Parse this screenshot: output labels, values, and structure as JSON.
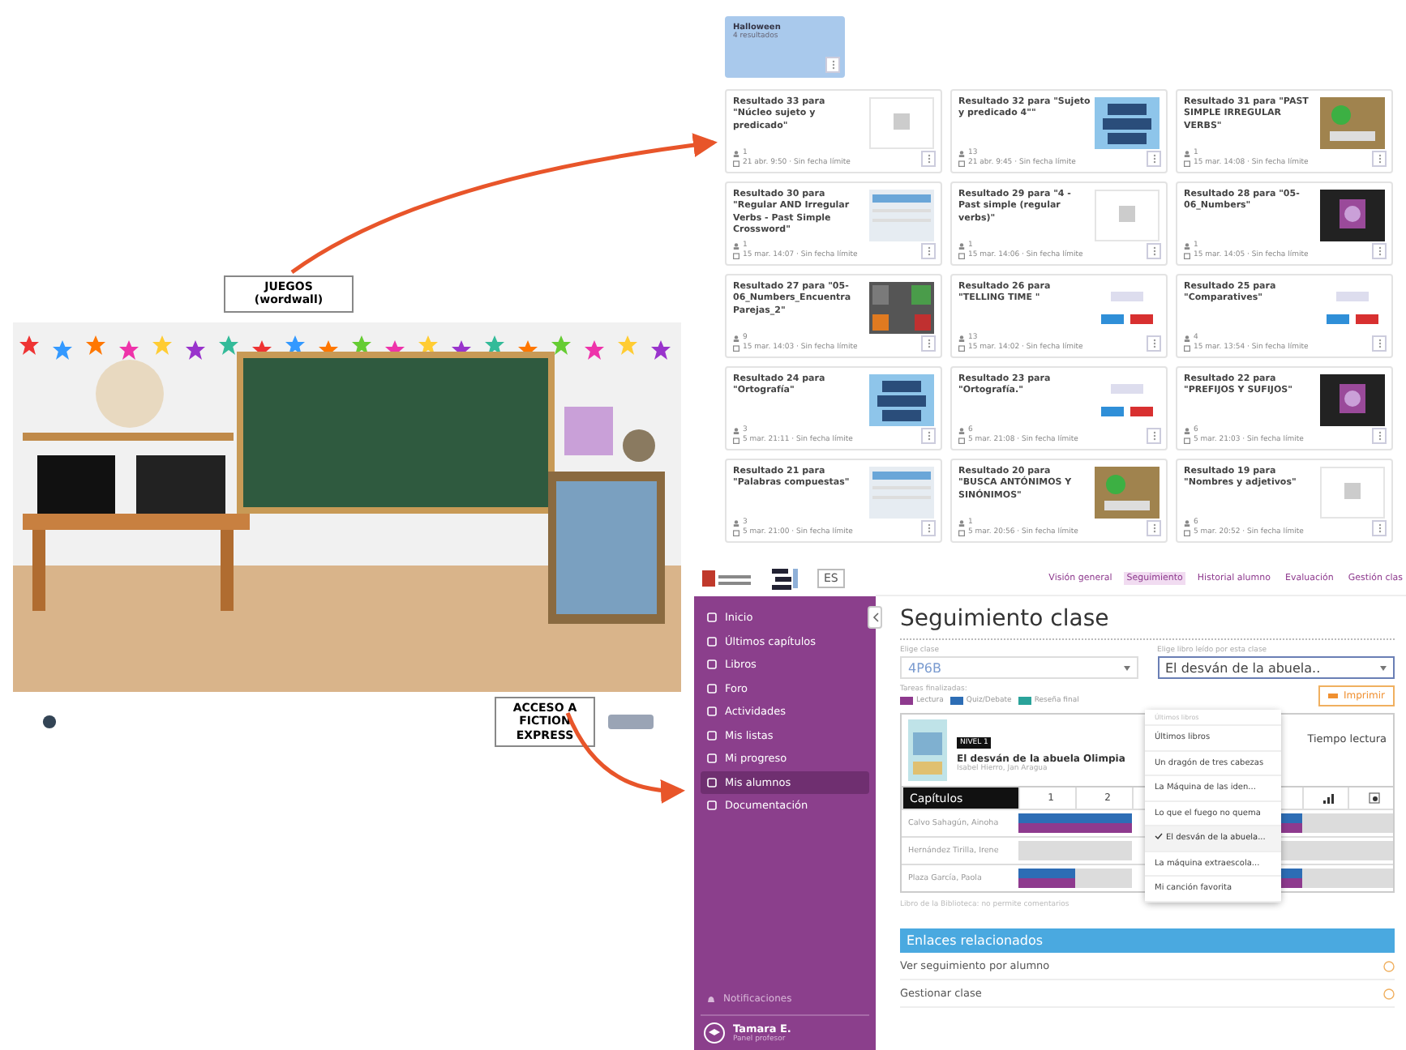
{
  "annotations": {
    "games_label": "JUEGOS (wordwall)",
    "fiction_label": "ACCESO A FICTION EXPRESS"
  },
  "wordwall": {
    "folder": {
      "title": "Halloween",
      "count": "4 resultados"
    },
    "results": [
      {
        "title": "Resultado 33 para \"Núcleo sujeto y predicado\"",
        "players": "1",
        "date": "21 abr. 9:50 · Sin fecha límite",
        "kind": "placeholder"
      },
      {
        "title": "Resultado 32 para \"Sujeto y predicado 4\"\"",
        "players": "13",
        "date": "21 abr. 9:45 · Sin fecha límite",
        "kind": "tiles"
      },
      {
        "title": "Resultado 31 para \"PAST SIMPLE IRREGULAR VERBS\"",
        "players": "1",
        "date": "15 mar. 14:08 · Sin fecha límite",
        "kind": "board"
      },
      {
        "title": "Resultado 30 para \"Regular AND Irregular Verbs - Past Simple Crossword\"",
        "players": "1",
        "date": "15 mar. 14:07 · Sin fecha límite",
        "kind": "lines"
      },
      {
        "title": "Resultado 29 para \"4 - Past simple (regular verbs)\"",
        "players": "1",
        "date": "15 mar. 14:06 · Sin fecha límite",
        "kind": "placeholder"
      },
      {
        "title": "Resultado 28 para \"05-06_Numbers\"",
        "players": "1",
        "date": "15 mar. 14:05 · Sin fecha límite",
        "kind": "dark"
      },
      {
        "title": "Resultado 27 para \"05-06_Numbers_Encuentra Parejas_2\"",
        "players": "9",
        "date": "15 mar. 14:03 · Sin fecha límite",
        "kind": "mosaic"
      },
      {
        "title": "Resultado 26 para \"TELLING TIME \"",
        "players": "13",
        "date": "15 mar. 14:02 · Sin fecha límite",
        "kind": "light"
      },
      {
        "title": "Resultado 25 para \"Comparatives\"",
        "players": "4",
        "date": "15 mar. 13:54 · Sin fecha límite",
        "kind": "light"
      },
      {
        "title": "Resultado 24 para \"Ortografía\"",
        "players": "3",
        "date": "5 mar. 21:11 · Sin fecha límite",
        "kind": "tiles"
      },
      {
        "title": "Resultado 23 para \"Ortografía.\"",
        "players": "6",
        "date": "5 mar. 21:08 · Sin fecha límite",
        "kind": "light"
      },
      {
        "title": "Resultado 22 para \"PREFIJOS Y SUFIJOS\"",
        "players": "6",
        "date": "5 mar. 21:03 · Sin fecha límite",
        "kind": "dark"
      },
      {
        "title": "Resultado 21 para \"Palabras compuestas\"",
        "players": "3",
        "date": "5 mar. 21:00 · Sin fecha límite",
        "kind": "lines"
      },
      {
        "title": "Resultado 20 para \"BUSCA ANTÓNIMOS Y SINÓNIMOS\"",
        "players": "1",
        "date": "5 mar. 20:56 · Sin fecha límite",
        "kind": "board"
      },
      {
        "title": "Resultado 19 para \"Nombres y adjetivos\"",
        "players": "6",
        "date": "5 mar. 20:52 · Sin fecha límite",
        "kind": "placeholder"
      }
    ]
  },
  "fiction_express": {
    "language": "ES",
    "sidebar": [
      {
        "label": "Inicio",
        "selected": false
      },
      {
        "label": "Últimos capítulos",
        "selected": false
      },
      {
        "label": "Libros",
        "selected": false
      },
      {
        "label": "Foro",
        "selected": false
      },
      {
        "label": "Actividades",
        "selected": false
      },
      {
        "label": "Mis listas",
        "selected": false
      },
      {
        "label": "Mi progreso",
        "selected": false
      },
      {
        "label": "Mis alumnos",
        "selected": true
      },
      {
        "label": "Documentación",
        "selected": false
      }
    ],
    "notifications": "Notificaciones",
    "user": {
      "name": "Tamara E.",
      "role": "Panel profesor"
    },
    "tabs": [
      {
        "label": "Visión general",
        "selected": false
      },
      {
        "label": "Seguimiento",
        "selected": true
      },
      {
        "label": "Historial alumno",
        "selected": false
      },
      {
        "label": "Evaluación",
        "selected": false
      },
      {
        "label": "Gestión clas",
        "selected": false
      }
    ],
    "title": "Seguimiento clase",
    "class_select": {
      "label": "Elige clase",
      "value": "4P6B"
    },
    "book_select": {
      "label": "Elige libro leído por esta clase",
      "value": "El desván de la abuela.."
    },
    "legend": {
      "label": "Tareas finalizadas:",
      "items": [
        {
          "label": "Lectura",
          "color": "#8e3a8e"
        },
        {
          "label": "Quiz/Debate",
          "color": "#2d6db5"
        },
        {
          "label": "Reseña final",
          "color": "#2aa39a"
        }
      ]
    },
    "print_button": "Imprimir",
    "book": {
      "level": "NIVEL 1",
      "title": "El desván de la abuela Olimpia",
      "author": "Isabel Hierro, Jan Aragua",
      "reading_time": "Tiempo lectura"
    },
    "dropdown": [
      {
        "label": "Últimos libros",
        "kind": "header",
        "selected": false
      },
      {
        "label": "Últimos libros",
        "kind": "option",
        "selected": false
      },
      {
        "label": "Un dragón de tres cabezas",
        "kind": "option",
        "selected": false
      },
      {
        "label": "La Máquina de las iden...",
        "kind": "option",
        "selected": false
      },
      {
        "label": "Lo que el fuego no quema",
        "kind": "option",
        "selected": false
      },
      {
        "label": "El desván de la abuela...",
        "kind": "option",
        "selected": true
      },
      {
        "label": "La máquina extraescola...",
        "kind": "option",
        "selected": false
      },
      {
        "label": "Mi canción favorita",
        "kind": "option",
        "selected": false
      }
    ],
    "table": {
      "header": "Capítulos",
      "chapters": [
        "1",
        "2"
      ],
      "rows": [
        {
          "student": "Calvo Sahagún, Ainoha",
          "done": [
            true,
            true,
            true
          ]
        },
        {
          "student": "Hernández Tirilla, Irene",
          "done": [
            false,
            false,
            false
          ]
        },
        {
          "student": "Plaza García, Paola",
          "done": [
            true,
            false,
            true
          ]
        }
      ]
    },
    "note": "Libro de la Biblioteca: no permite comentarios",
    "links_title": "Enlaces relacionados",
    "links": [
      "Ver seguimiento por alumno",
      "Gestionar clase"
    ]
  }
}
